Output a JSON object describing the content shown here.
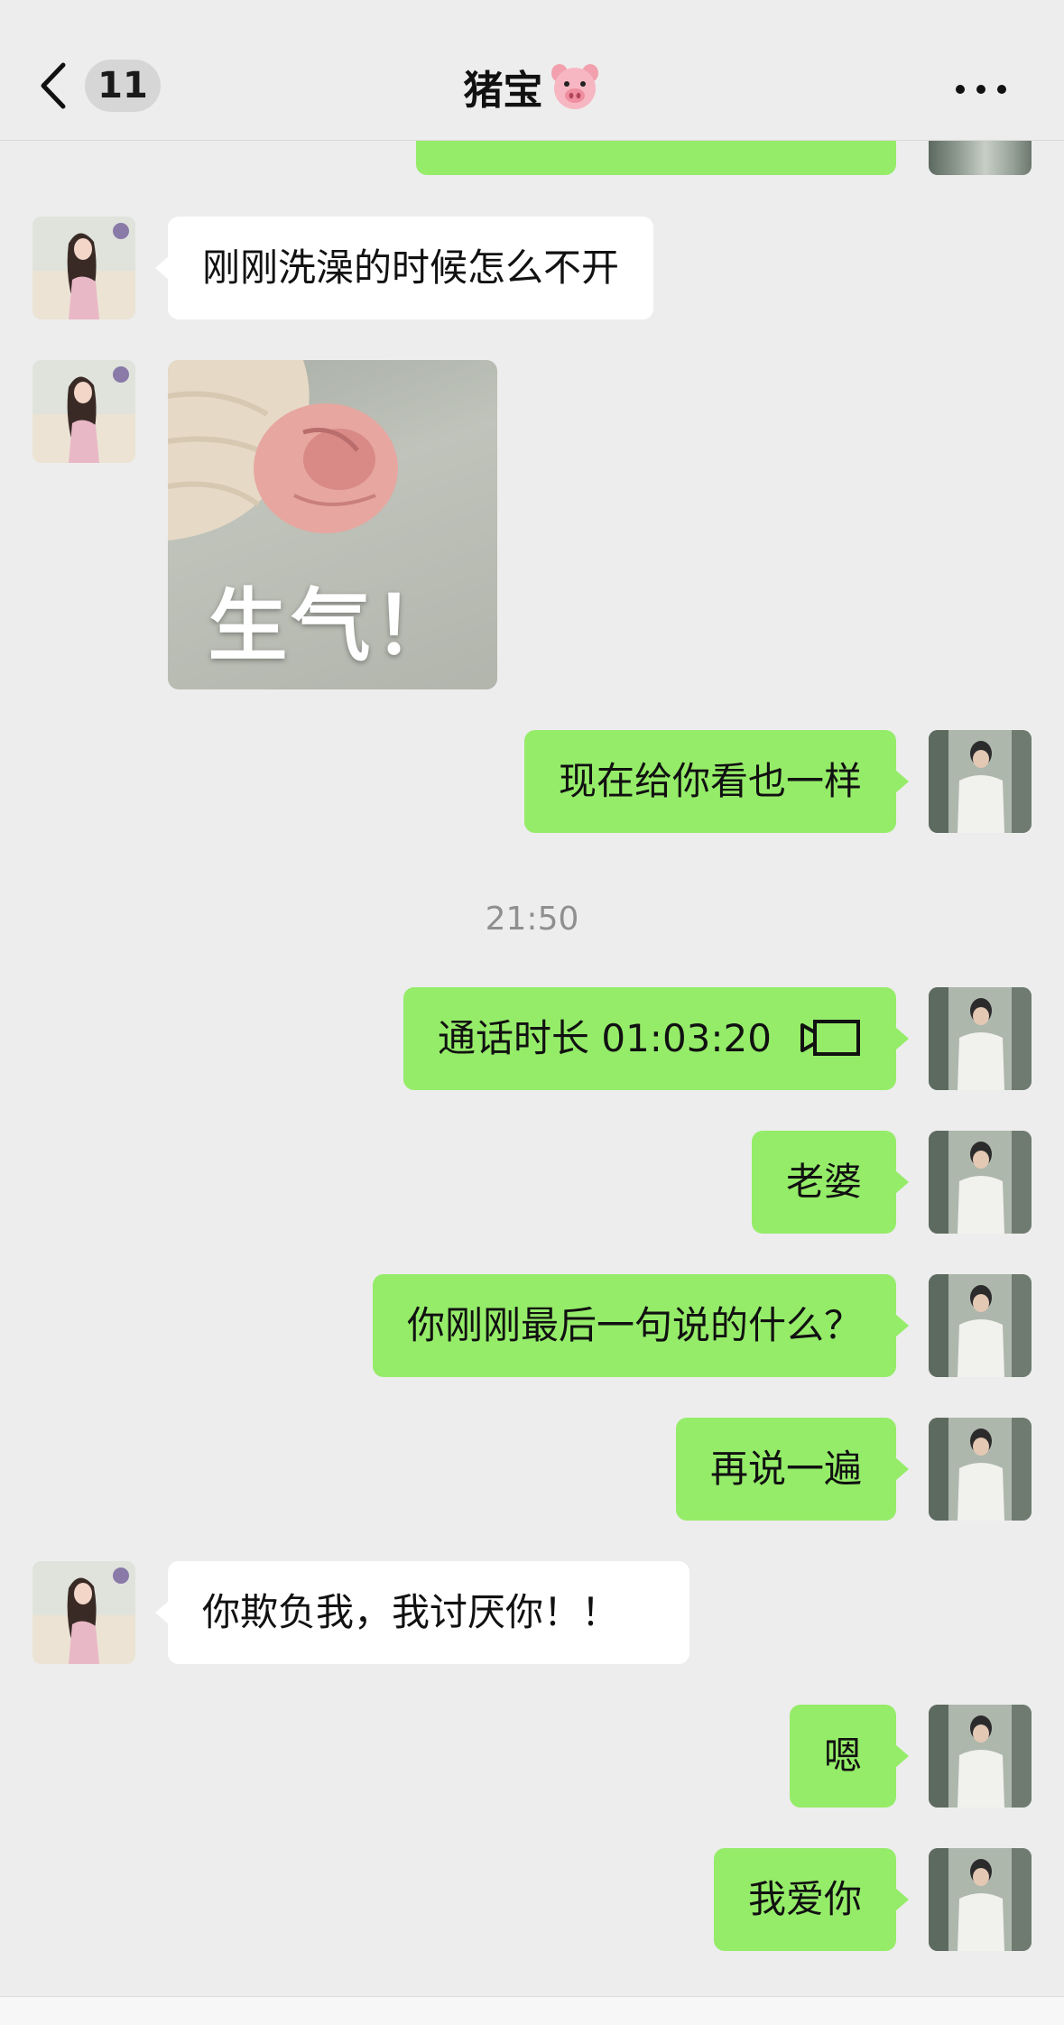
{
  "header": {
    "unread_count": "11",
    "title": "猪宝",
    "title_icon": "pig-face-icon",
    "back_icon": "chevron-left-icon",
    "more_icon": "more-dots-icon"
  },
  "messages": {
    "m1": "刚刚洗澡的时候怎么不开",
    "sticker_caption": "生气！",
    "m3": "现在给你看也一样",
    "timestamp": "21:50",
    "call": "通话时长 01:03:20",
    "m5": "老婆",
    "m6": "你刚刚最后一句说的什么？",
    "m7": "再说一遍",
    "m8": "你欺负我，我讨厌你！！",
    "m9": "嗯",
    "m10": "我爱你"
  },
  "colors": {
    "outgoing_bubble": "#95ec69",
    "incoming_bubble": "#ffffff",
    "background": "#ededed"
  }
}
